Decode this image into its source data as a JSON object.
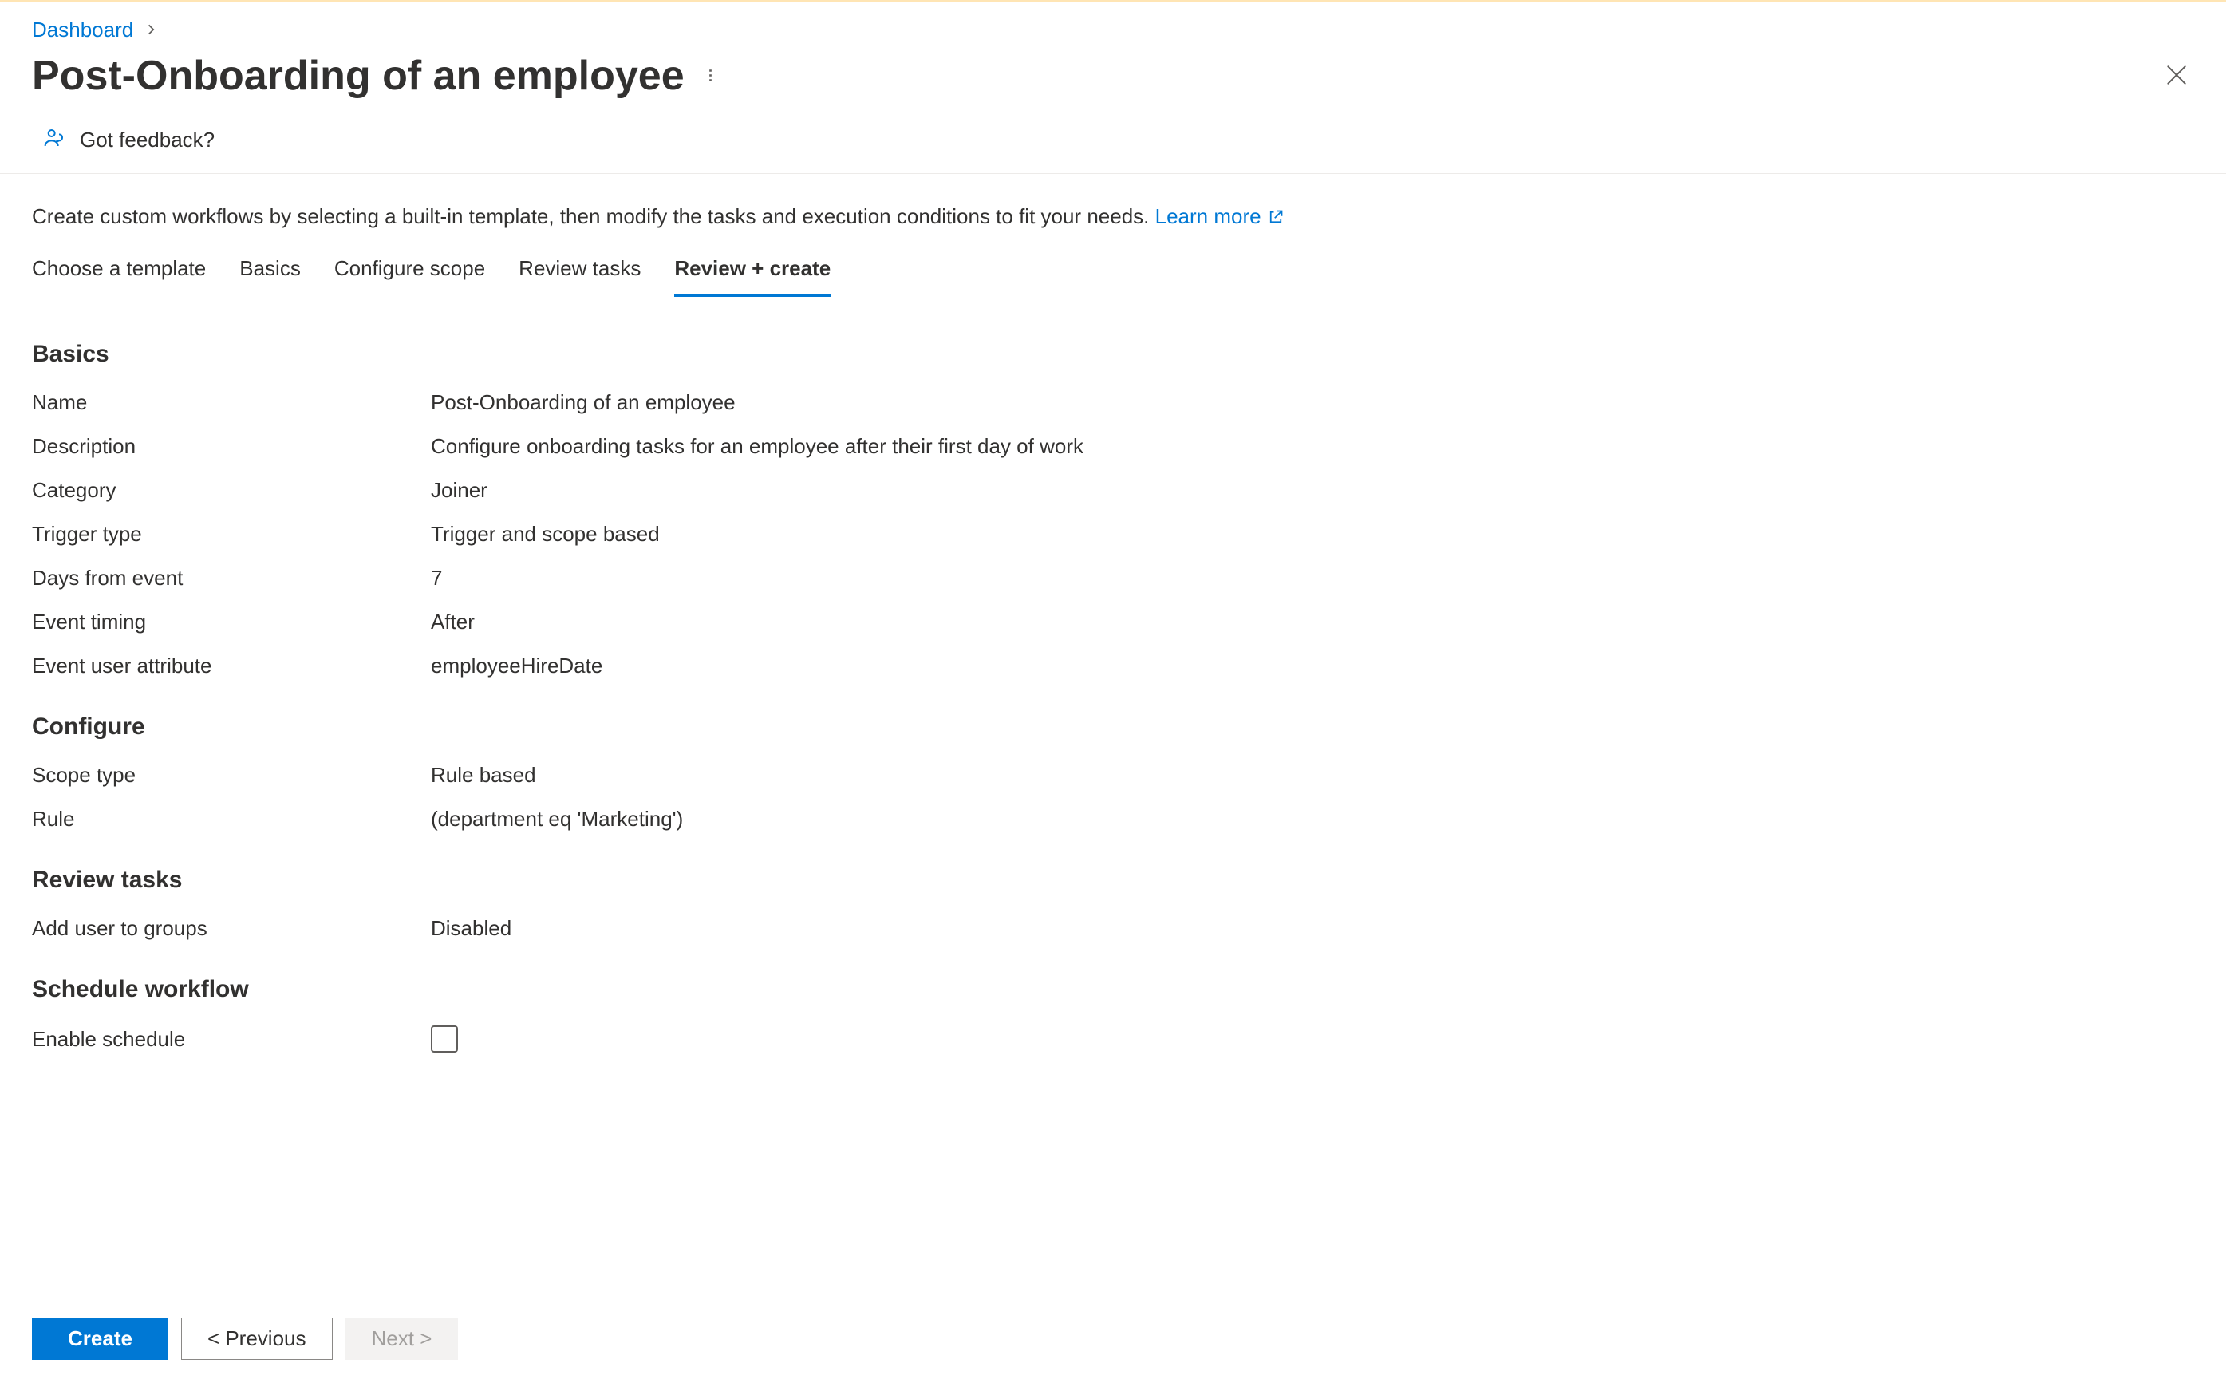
{
  "breadcrumb": {
    "link": "Dashboard"
  },
  "header": {
    "title": "Post-Onboarding of an employee"
  },
  "feedback": {
    "label": "Got feedback?"
  },
  "intro": {
    "text": "Create custom workflows by selecting a built-in template, then modify the tasks and execution conditions to fit your needs.",
    "learn_more": "Learn more"
  },
  "tabs": {
    "choose_template": "Choose a template",
    "basics": "Basics",
    "configure_scope": "Configure scope",
    "review_tasks": "Review tasks",
    "review_create": "Review + create"
  },
  "sections": {
    "basics": {
      "heading": "Basics",
      "name_label": "Name",
      "name_value": "Post-Onboarding of an employee",
      "description_label": "Description",
      "description_value": "Configure onboarding tasks for an employee after their first day of work",
      "category_label": "Category",
      "category_value": "Joiner",
      "trigger_type_label": "Trigger type",
      "trigger_type_value": "Trigger and scope based",
      "days_from_event_label": "Days from event",
      "days_from_event_value": "7",
      "event_timing_label": "Event timing",
      "event_timing_value": "After",
      "event_user_attr_label": "Event user attribute",
      "event_user_attr_value": "employeeHireDate"
    },
    "configure": {
      "heading": "Configure",
      "scope_type_label": "Scope type",
      "scope_type_value": "Rule based",
      "rule_label": "Rule",
      "rule_value": "(department eq 'Marketing')"
    },
    "review_tasks": {
      "heading": "Review tasks",
      "add_user_label": "Add user to groups",
      "add_user_value": "Disabled"
    },
    "schedule": {
      "heading": "Schedule workflow",
      "enable_label": "Enable schedule"
    }
  },
  "footer": {
    "create": "Create",
    "previous": "< Previous",
    "next": "Next >"
  }
}
